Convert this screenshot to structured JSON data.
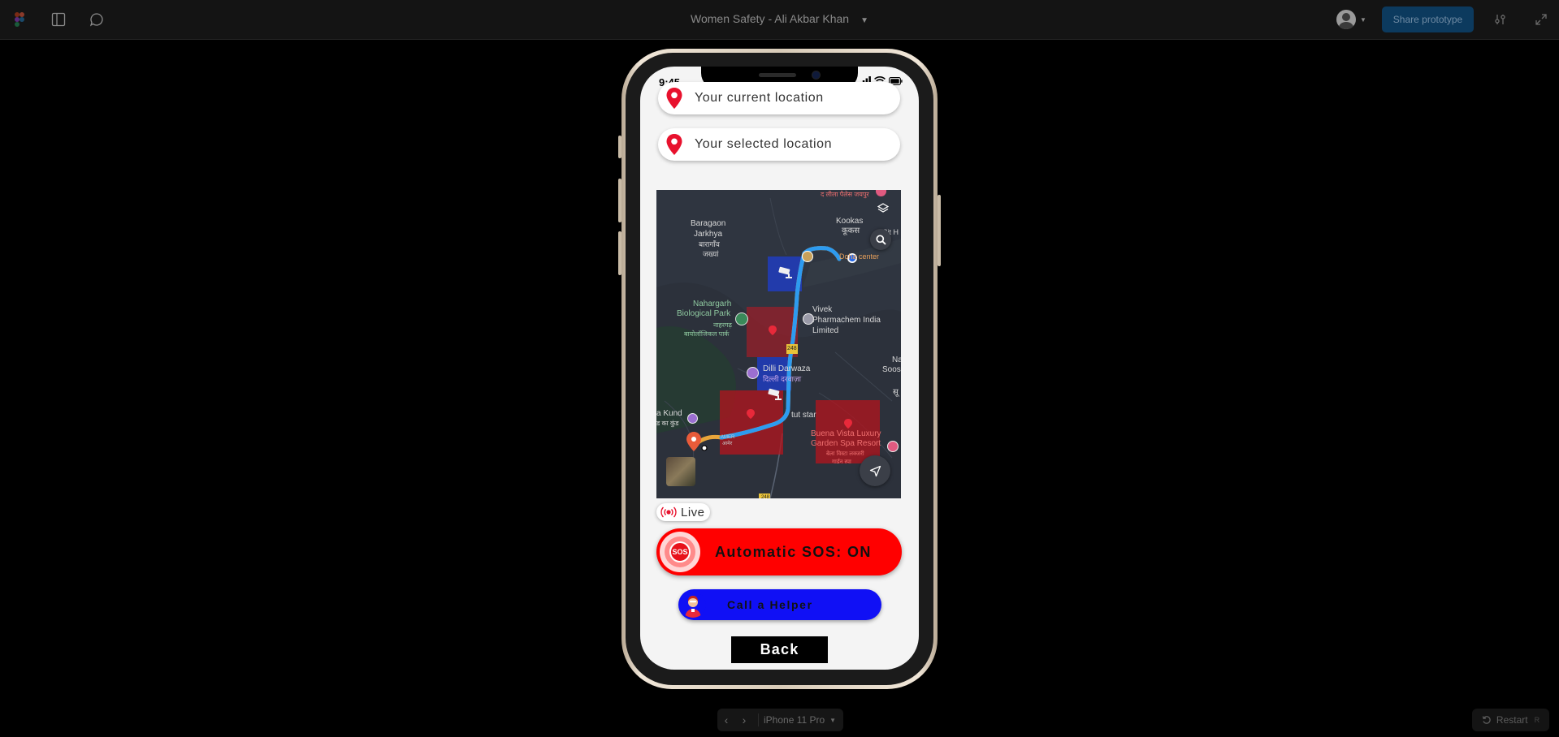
{
  "figma": {
    "title": "Women Safety - Ali Akbar Khan",
    "share_label": "Share prototype",
    "device_label": "iPhone 11 Pro",
    "restart_label": "Restart"
  },
  "phone": {
    "status_time": "9:45",
    "current_location_placeholder": "Your current location",
    "selected_location_placeholder": "Your selected location",
    "live_label": "Live",
    "sos_label": "Automatic SOS: ON",
    "helper_label": "Call a Helper",
    "back_label": "Back"
  },
  "map": {
    "labels": {
      "top_hotel": "द लीला पैलेस जयपुर",
      "baragaon": "Baragaon",
      "jarkhya": "Jarkhya",
      "baragaon_hi": "बारागाँव",
      "jarkhya_hi": "जख्यां",
      "kookas": "Kookas",
      "kookas_hi": "कूकस",
      "cit": "Cit H",
      "doha": "Doha center",
      "nahargarh": "Nahargarh",
      "bio_park": "Biological Park",
      "nahargarh_hi": "नाहरगढ़",
      "bio_park_hi": "बायोलॉजिकल पार्क",
      "vivek1": "Vivek",
      "vivek2": "Pharmachem India",
      "vivek3": "Limited",
      "road_248": "248",
      "dilli_darwaza": "Dilli Darwaza",
      "dilli_darwaza_hi": "दिल्ली दरवाज़ा",
      "na": "Na",
      "soos": "Soos",
      "su": "सू",
      "kund": "a Kund",
      "kund_hi": "ड का कुंड",
      "tut_star": "tut star",
      "buena1": "Buena Vista Luxury",
      "buena2": "Garden Spa Resort",
      "buena_hi1": "बेला विस्टा लक्जरी",
      "buena_hi2": "गार्डन स्पा",
      "amer": "AMER",
      "amer_hi": "आमेर",
      "road_248b": "248"
    }
  },
  "colors": {
    "sos_red": "#ff0000",
    "helper_blue": "#1010f5",
    "share_blue": "#0c3a5e",
    "pin_red": "#e8112d"
  },
  "icons": [
    "figma-logo-icon",
    "sidebar-panel-icon",
    "comment-icon",
    "chevron-down-icon",
    "user-avatar-icon",
    "settings-sliders-icon",
    "expand-icon",
    "location-pin-icon",
    "layers-icon",
    "search-icon",
    "navigate-arrow-icon",
    "cctv-camera-icon",
    "danger-marker-icon",
    "broadcast-icon",
    "sos-icon",
    "helper-avatar-icon",
    "restart-icon"
  ]
}
